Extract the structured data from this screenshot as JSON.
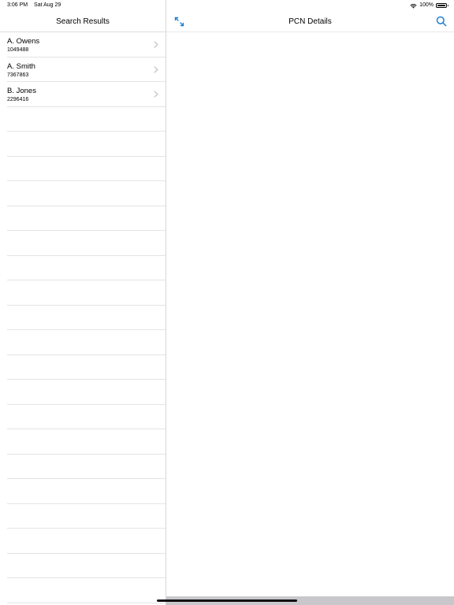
{
  "status_bar": {
    "time": "3:06 PM",
    "date": "Sat Aug 29",
    "battery_percent": "100%",
    "battery_level": 1.0
  },
  "master": {
    "title": "Search Results",
    "items": [
      {
        "name": "A. Owens",
        "id": "1049488"
      },
      {
        "name": "A. Smith",
        "id": "7367863"
      },
      {
        "name": "B. Jones",
        "id": "2296416"
      }
    ]
  },
  "detail": {
    "title": "PCN Details",
    "expand_icon": "expand-arrows-icon",
    "search_icon": "search-icon"
  },
  "colors": {
    "accent": "#1a7fd4",
    "separator": "#e4e4e8",
    "chevron": "#c4c4c9"
  }
}
